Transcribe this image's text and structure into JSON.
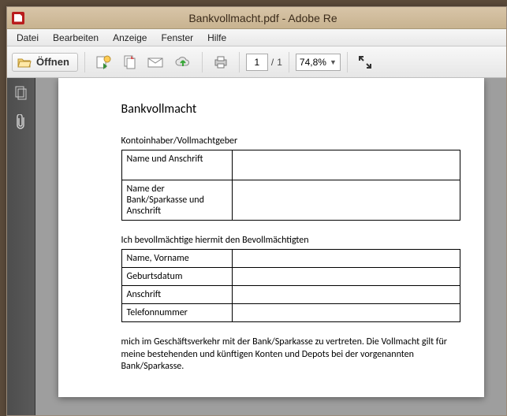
{
  "window": {
    "title": "Bankvollmacht.pdf - Adobe Re"
  },
  "menu": {
    "file": "Datei",
    "edit": "Bearbeiten",
    "view": "Anzeige",
    "window": "Fenster",
    "help": "Hilfe"
  },
  "toolbar": {
    "open": "Öffnen",
    "page_current": "1",
    "page_sep": "/",
    "page_total": "1",
    "zoom": "74,8%"
  },
  "doc": {
    "title": "Bankvollmacht",
    "section1_label": "Kontoinhaber/Vollmachtgeber",
    "t1_r1": "Name und Anschrift",
    "t1_r2": "Name der Bank/Sparkasse und Anschrift",
    "section2_label": "Ich bevollmächtige hiermit den Bevollmächtigten",
    "t2_r1": "Name, Vorname",
    "t2_r2": "Geburtsdatum",
    "t2_r3": "Anschrift",
    "t2_r4": "Telefonnummer",
    "para": "mich im Geschäftsverkehr mit der Bank/Sparkasse zu vertreten. Die Vollmacht gilt für meine bestehenden und künftigen Konten und Depots bei der vorgenannten Bank/Sparkasse."
  }
}
